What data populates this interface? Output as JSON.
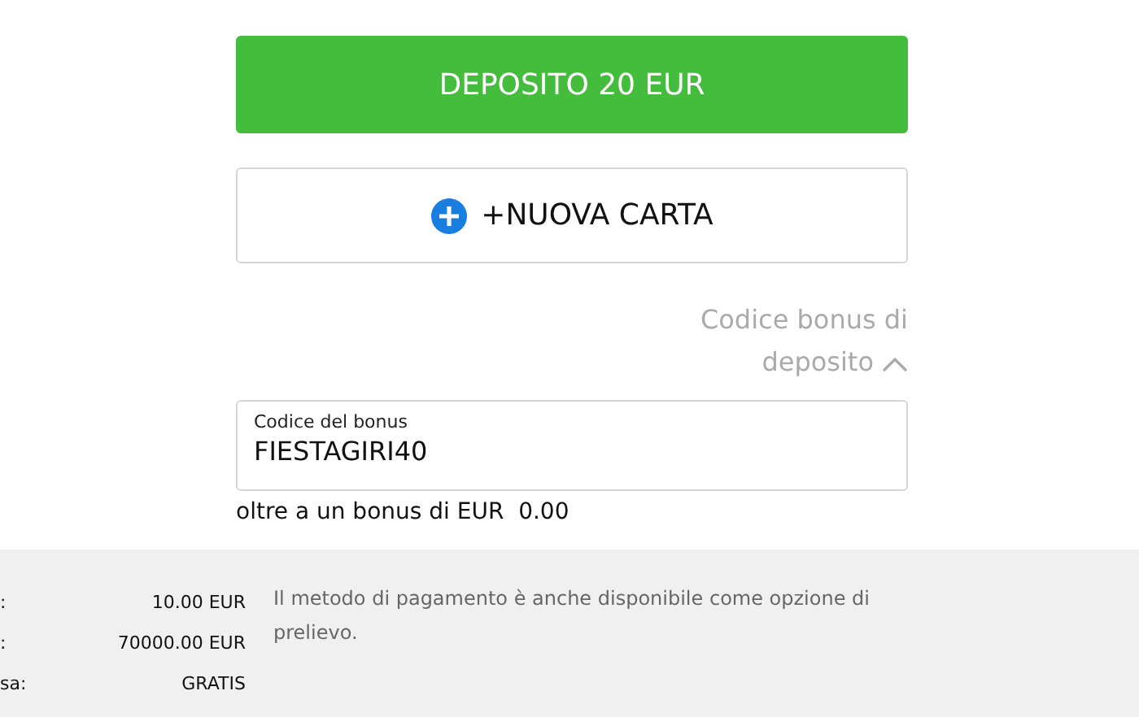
{
  "deposit_button": {
    "label": "DEPOSITO 20 EUR"
  },
  "new_card_button": {
    "label": "+NUOVA CARTA"
  },
  "bonus_toggle": {
    "label": "Codice bonus di deposito",
    "expanded": true
  },
  "bonus_field": {
    "label": "Codice del bonus",
    "value": "FIESTAGIRI40"
  },
  "bonus_note": "oltre a un bonus di EUR  0.00",
  "info_rows": [
    {
      "label": ":",
      "value": "10.00 EUR"
    },
    {
      "label": ":",
      "value": "70000.00 EUR"
    },
    {
      "label": "sa:",
      "value": "GRATIS"
    }
  ],
  "info_message": "Il metodo di pagamento è anche disponibile come opzione di prelievo."
}
